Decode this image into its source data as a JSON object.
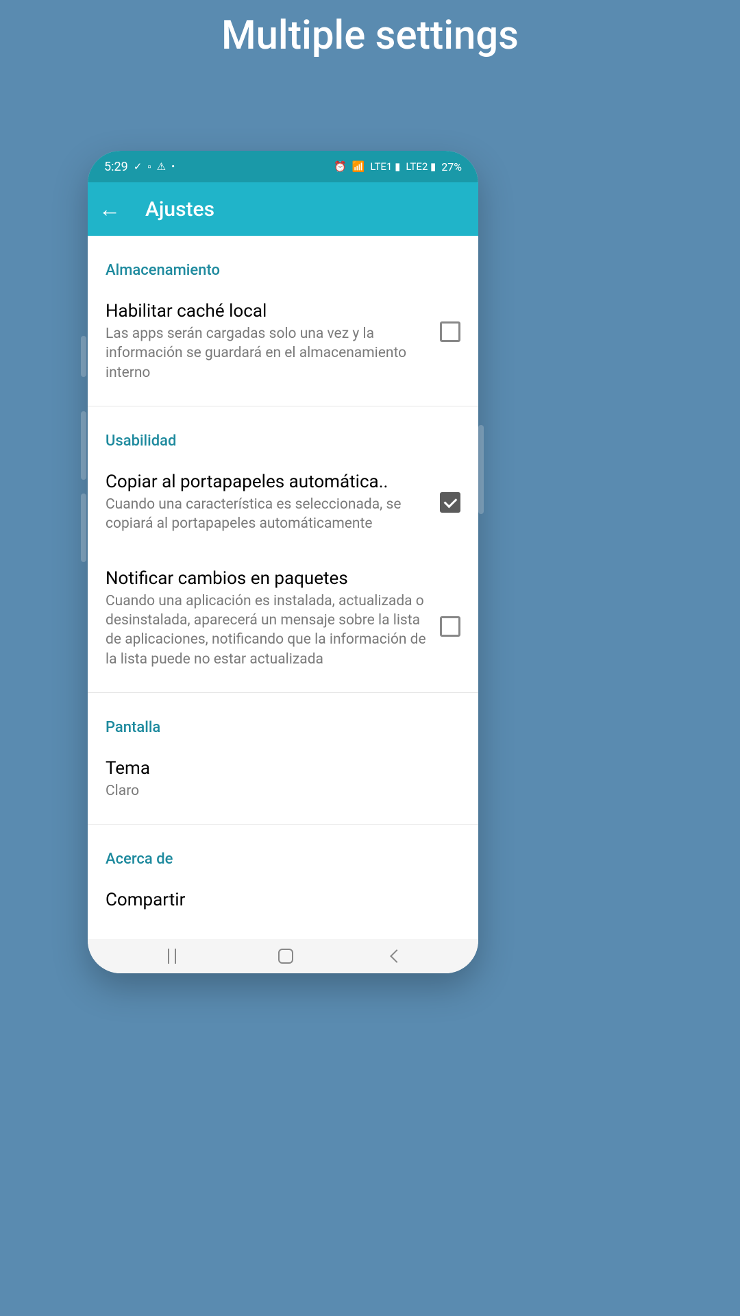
{
  "page_heading": "Multiple settings",
  "status_bar": {
    "time": "5:29",
    "battery": "27%"
  },
  "app_bar": {
    "title": "Ajustes"
  },
  "sections": {
    "storage": {
      "header": "Almacenamiento",
      "cache": {
        "title": "Habilitar caché local",
        "desc": "Las apps serán cargadas solo una vez y la información se guardará en el almacenamiento interno",
        "checked": false
      }
    },
    "usability": {
      "header": "Usabilidad",
      "clipboard": {
        "title": "Copiar al portapapeles automática..",
        "desc": "Cuando una característica es seleccionada, se copiará al portapapeles automáticamente",
        "checked": true
      },
      "notify": {
        "title": "Notificar cambios en paquetes",
        "desc": "Cuando una aplicación es instalada, actualizada o desinstalada, aparecerá un mensaje sobre la lista de aplicaciones, notificando que la información de la lista puede no estar actualizada",
        "checked": false
      }
    },
    "display": {
      "header": "Pantalla",
      "theme": {
        "title": "Tema",
        "value": "Claro"
      }
    },
    "about": {
      "header": "Acerca de",
      "share": {
        "title": "Compartir"
      }
    }
  }
}
